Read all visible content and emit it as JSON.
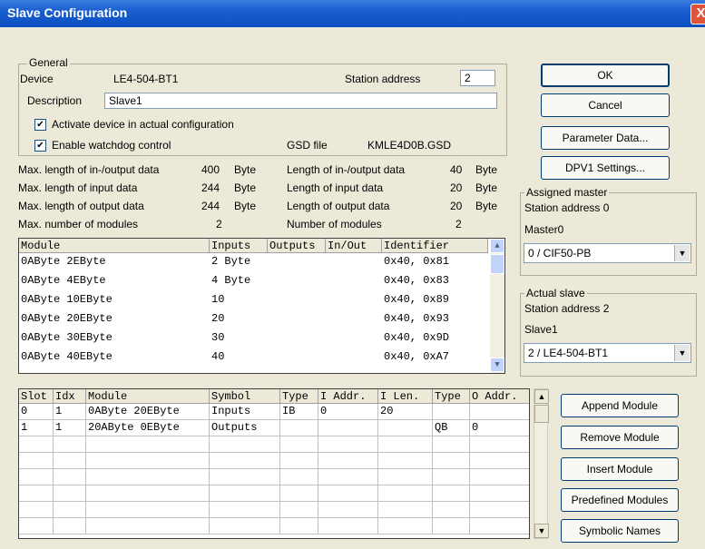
{
  "window": {
    "title": "Slave Configuration",
    "close_glyph": "X"
  },
  "general": {
    "group_label": "General",
    "device_label": "Device",
    "device_value": "LE4-504-BT1",
    "station_address_label": "Station address",
    "station_address_value": "2",
    "description_label": "Description",
    "description_value": "Slave1",
    "activate_label": "Activate device in actual configuration",
    "watchdog_label": "Enable watchdog control",
    "gsd_label": "GSD file",
    "gsd_value": "KMLE4D0B.GSD",
    "check_glyph": "✔"
  },
  "stats": {
    "max_io_label": "Max. length of in-/output data",
    "max_io_value": "400",
    "max_io_unit": "Byte",
    "max_in_label": "Max. length of input data",
    "max_in_value": "244",
    "max_in_unit": "Byte",
    "max_out_label": "Max. length of output data",
    "max_out_value": "244",
    "max_out_unit": "Byte",
    "max_mod_label": "Max. number of modules",
    "max_mod_value": "2",
    "len_io_label": "Length of in-/output data",
    "len_io_value": "40",
    "len_io_unit": "Byte",
    "len_in_label": "Length of input data",
    "len_in_value": "20",
    "len_in_unit": "Byte",
    "len_out_label": "Length of output data",
    "len_out_value": "20",
    "len_out_unit": "Byte",
    "num_mod_label": "Number of modules",
    "num_mod_value": "2"
  },
  "module_list": {
    "headers": [
      "Module",
      "Inputs",
      "Outputs",
      "In/Out",
      "Identifier"
    ],
    "rows": [
      [
        "0AByte  2EByte",
        "2 Byte",
        "",
        "",
        "0x40, 0x81"
      ],
      [
        "0AByte  4EByte",
        "4 Byte",
        "",
        "",
        "0x40, 0x83"
      ],
      [
        "0AByte 10EByte",
        "10",
        "",
        "",
        "0x40, 0x89"
      ],
      [
        "0AByte 20EByte",
        "20",
        "",
        "",
        "0x40, 0x93"
      ],
      [
        "0AByte 30EByte",
        "30",
        "",
        "",
        "0x40, 0x9D"
      ],
      [
        "0AByte 40EByte",
        "40",
        "",
        "",
        "0x40, 0xA7"
      ]
    ]
  },
  "slot_table": {
    "headers": [
      "Slot",
      "Idx",
      "Module",
      "Symbol",
      "Type",
      "I Addr.",
      "I Len.",
      "Type",
      "O Addr."
    ],
    "rows": [
      [
        "0",
        "1",
        "0AByte 20EByte",
        "Inputs",
        "IB",
        "0",
        "20",
        "",
        ""
      ],
      [
        "1",
        "1",
        "20AByte 0EByte",
        "Outputs",
        "",
        "",
        "",
        "QB",
        "0"
      ],
      [
        "",
        "",
        "",
        "",
        "",
        "",
        "",
        "",
        ""
      ],
      [
        "",
        "",
        "",
        "",
        "",
        "",
        "",
        "",
        ""
      ],
      [
        "",
        "",
        "",
        "",
        "",
        "",
        "",
        "",
        ""
      ],
      [
        "",
        "",
        "",
        "",
        "",
        "",
        "",
        "",
        ""
      ],
      [
        "",
        "",
        "",
        "",
        "",
        "",
        "",
        "",
        ""
      ],
      [
        "",
        "",
        "",
        "",
        "",
        "",
        "",
        "",
        ""
      ]
    ]
  },
  "buttons": {
    "ok": "OK",
    "cancel": "Cancel",
    "parameter_data": "Parameter Data...",
    "dpv1_settings": "DPV1 Settings...",
    "append_module": "Append Module",
    "remove_module": "Remove Module",
    "insert_module": "Insert Module",
    "predefined_modules": "Predefined Modules",
    "symbolic_names": "Symbolic Names"
  },
  "assigned_master": {
    "group_label": "Assigned master",
    "station_address": "Station address 0",
    "name": "Master0",
    "selected": "0 / CIF50-PB"
  },
  "actual_slave": {
    "group_label": "Actual slave",
    "station_address": "Station address 2",
    "name": "Slave1",
    "selected": "2 / LE4-504-BT1"
  },
  "scroll_glyphs": {
    "up": "▲",
    "down": "▼",
    "combo": "▼"
  }
}
